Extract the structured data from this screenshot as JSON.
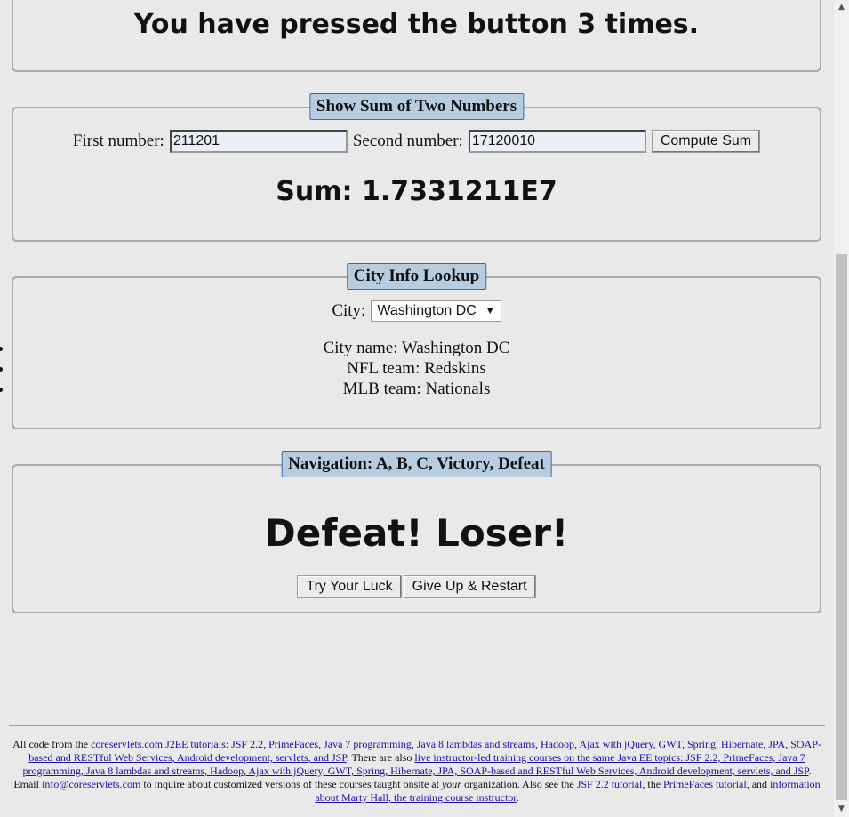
{
  "counter": {
    "message": "You have pressed the button 3 times."
  },
  "sum_panel": {
    "legend": "Show Sum of Two Numbers",
    "first_label": "First number:",
    "first_value": "211201",
    "second_label": "Second number:",
    "second_value": "17120010",
    "button_label": "Compute Sum",
    "result": "Sum: 1.7331211E7"
  },
  "city_panel": {
    "legend": "City Info Lookup",
    "city_label": "City:",
    "city_selected": "Washington DC",
    "city_dropdown_icon": "triangle-down",
    "info": [
      "City name: Washington DC",
      "NFL team: Redskins",
      "MLB team: Nationals"
    ]
  },
  "nav_panel": {
    "legend": "Navigation: A, B, C, Victory, Defeat",
    "result": "Defeat! Loser!",
    "try_button": "Try Your Luck",
    "giveup_button": "Give Up & Restart"
  },
  "footer": {
    "t1": "All code from the ",
    "l1": "coreservlets.com J2EE tutorials: JSF 2.2, PrimeFaces, Java 7 programming, Java 8 lambdas and streams, Hadoop, Ajax with jQuery, GWT, Spring, Hibernate, JPA, SOAP-based and RESTful Web Services, Android development, servlets, and JSP",
    "t2": ". There are also ",
    "l2": "live instructor-led training courses on the same Java EE topics: JSF 2.2, PrimeFaces, Java 7 programming, Java 8 lambdas and streams, Hadoop, Ajax with jQuery, GWT, Spring, Hibernate, JPA, SOAP-based and RESTful Web Services, Android development, servlets, and JSP",
    "t3": ". Email ",
    "l3": "info@coreservlets.com",
    "t4": " to inquire about customized versions of these courses taught onsite at ",
    "t5": "your",
    "t6": " organization. Also see the ",
    "l4": "JSF 2.2 tutorial",
    "t7": ", the ",
    "l5": "PrimeFaces tutorial",
    "t8": ", and ",
    "l6": "information about Marty Hall, the training course instructor",
    "t9": "."
  },
  "scrollbar": {
    "up_icon": "scroll-up-arrow",
    "down_icon": "scroll-down-arrow"
  }
}
